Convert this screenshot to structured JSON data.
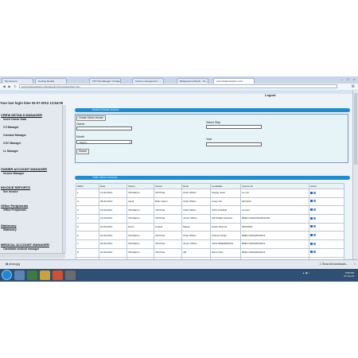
{
  "browser": {
    "tabs": [
      {
        "label": "My Account"
      },
      {
        "label": "Hosting Details"
      },
      {
        "label": "FTP File Manager | bridges"
      },
      {
        "label": "Invoice management - ..."
      },
      {
        "label": "Bridgeview Infotech - Se..."
      },
      {
        "label": "www.shipboardjobs.net/s"
      }
    ],
    "url": "www.shipboardjobs.in/bridgeadmin/invoicelist/client.htm"
  },
  "header": {
    "logout": "Logout",
    "last_login": "Your last login time 03-07-2013 13:54:09"
  },
  "sidebar": {
    "sections": [
      {
        "title": "CREW DETAILS MANAGER",
        "items": [
          "Insert Owner Data",
          "CV Manager",
          "Contract Manager",
          "COC Manager",
          "LL Manager"
        ]
      },
      {
        "title": "OWNER ACCOUNT MANAGER",
        "items": [
          "Invoice Manager"
        ]
      },
      {
        "title": "INVOICE REPORTS",
        "items": [
          "See Invoice"
        ]
      },
      {
        "title": "Office Peripherals",
        "items": [
          "Office Peripherals"
        ]
      },
      {
        "title": "Stationary",
        "items": [
          "Stationary"
        ]
      },
      {
        "title": "MEDICAL ACCOUNT MANAGER",
        "items": [
          "Candidate medical manager"
        ]
      }
    ]
  },
  "form": {
    "section_title": "Search Owner Invoice",
    "create_button": "Create Owner Invoice",
    "owner_label": "Owner",
    "select_ship_label": "Select Ship",
    "month_label": "Month",
    "month_value": "--Select--",
    "year_label": "Year",
    "search_button": "Search"
  },
  "table": {
    "section_title": "Total Owner Invoices",
    "columns": [
      "SRNo.",
      "Date",
      "Owner",
      "Vessel",
      "Rank",
      "Candidate",
      "Invoice No",
      "Action"
    ],
    "rows": [
      [
        "1",
        "14-06-2013",
        "VM Marine",
        "VM Pride",
        "Chief Officer",
        "Sanjay Joshi",
        "vm-ooi",
        ""
      ],
      [
        "2",
        "05-06-2013",
        "sandi",
        "Bulk Carrier",
        "Chief Officer",
        "Amey Giri",
        "04/13/12",
        ""
      ],
      [
        "3",
        "19-06-2013",
        "VM Marine",
        "VM Pride",
        "Chief Officer",
        "AJAY KUMAR",
        "vm/oo2",
        ""
      ],
      [
        "4",
        "19-06-2013",
        "VM Marine",
        "VM Pride",
        "Junior Officer",
        "Atif Shaikh Afsaned",
        "BMPL/VM/31/06/2013/004",
        ""
      ],
      [
        "5",
        "20-06-2013",
        "Nexin",
        "Ansbel",
        "Master",
        "Girish Sharma",
        "09/03/001",
        ""
      ],
      [
        "6",
        "20-06-2013",
        "VM Marine",
        "VM Pride",
        "Chief Officer",
        "Praneet Singh",
        "BMPL/VM/32/06/2013",
        ""
      ],
      [
        "7",
        "20-06-2013",
        "VM Marine",
        "VM Pride",
        "Junior Officer",
        "JACK BREMMISON",
        "BMPL/VM/33/06/2013",
        ""
      ],
      [
        "8",
        "20-06-2013",
        "VM Marine",
        "VM Pride",
        "AB",
        "RAJU RAJ",
        "BMPL/VM/34/06/2013",
        ""
      ],
      [
        "9",
        "20-06-2013",
        "VM Marine",
        "VM Prudent",
        "AB",
        "Jack BREMMISON",
        "BMPL/VM/35/06/2013",
        ""
      ]
    ]
  },
  "downloads": {
    "file": "photo.jpg",
    "show_all": "Show all downloads..."
  },
  "taskbar": {
    "time": "3:55 PM",
    "date": "07-Jul-13"
  },
  "colors": {
    "accent_bar": "#1d8fd0",
    "taskbar": "#2f4f73"
  }
}
